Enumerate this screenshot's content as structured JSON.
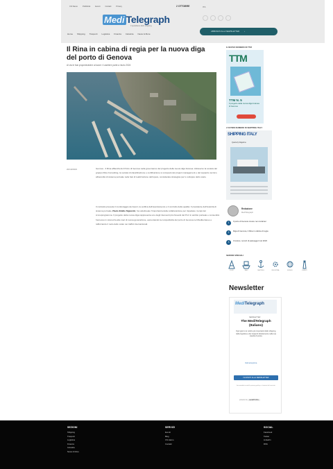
{
  "header": {
    "top_links": [
      "Chi Siamo",
      "Pubblicità",
      "Eventi",
      "Contatti",
      "Privacy"
    ],
    "date": "2 OTTOBRE",
    "lang": "ITA",
    "logo_prefix": "Medi",
    "logo_main": "Telegraph",
    "logo_sub": "Il quotidiano dello shipping",
    "nav": [
      "Home",
      "Shipping",
      "Trasporti",
      "Logistica",
      "Finanza",
      "Industria",
      "News & More"
    ],
    "cta": "ABBONATI ALLA NEWSLETTER",
    "cta_arrow": "›"
  },
  "article": {
    "title": "Il Rina in cabina di regia per la nuova diga del porto di Genova",
    "subtitle": "Al via le fasi propedeutiche ai lavori: il cantiere parte a inizio 2024",
    "date": "20/10/2023",
    "paragraph1": "Genova - Il Rina affiancherà il Porto di Genova nella governance del progetto della nuova diga foranea. Attraverso la società del gruppo Rina Consulting, la società di classificazione e certificazione si occuperà del project management e del supporto tecnico all'autorità di sistema portuale nelle fasi di realizzazione dell'opera, considerata strategica per lo sviluppo dello scalo.",
    "paragraph2_start": "Il contratto prevede il monitoraggio dei lavori, la verifica dell'avanzamento e il controllo della qualità. Il presidente dell'Autorità di sistema portuale, ",
    "paragraph2_bold": "Paolo Emilio Signorini",
    "paragraph2_end": ", ha sottolineato l'importanza della collaborazione per rispettare i tempi del cronoprogramma. Il progetto della nuova diga rappresenta uno degli interventi più rilevanti del Pnrr in ambito portuale e consentirà l'accesso in sicurezza alle navi di nuova generazione, aumentando la competitività del porto di Genova nel Mediterraneo e rafforzando il ruolo dello scalo nei traffici internazionali."
  },
  "sidebar": {
    "tm_section": "IL NUOVO NUMERO DI TTM",
    "tm_logo": "TTM",
    "tm_title": "TTM N. 5",
    "tm_subtitle": "Il progetto della nuova diga foranea di Genova",
    "shipping_section": "L'ULTIMO NUMERO DI SHIPPING ITALY",
    "shipping_logo": "SHIPPING ITALY",
    "shipping_sub": "Quarterly Magazine",
    "author_name": "Redazione",
    "author_role": "MediTelegraph",
    "ranking": [
      {
        "num": "1",
        "text": "Il porto di Genova cresce nei container"
      },
      {
        "num": "2",
        "text": "Diga di Genova, il Rina in cabina di regia"
      },
      {
        "num": "3",
        "text": "Crociere, record di passeggeri nel 2023"
      }
    ],
    "icons_section": "SEZIONI SPECIALI",
    "icons": [
      {
        "name": "ports-icon",
        "label": "PORTI"
      },
      {
        "name": "ship-icon",
        "label": "NAVI"
      },
      {
        "name": "anchor-icon",
        "label": "SHIPPING"
      },
      {
        "name": "gear-icon",
        "label": "INDUSTRIA"
      },
      {
        "name": "globe-icon",
        "label": "MONDO"
      },
      {
        "name": "lighthouse-icon",
        "label": "EVENTI"
      }
    ],
    "newsletter": {
      "title": "Newsletter",
      "logo_prefix": "Medi",
      "logo_main": "Telegraph",
      "kicker": "NEWSLETTER",
      "name": "The MediTelegraph (Italiano)",
      "desc": "Ogni giorno le notizie più importanti dello shipping, della logistica e dei trasporti direttamente nella tua casella di posta.",
      "link": "Vedi anteprima",
      "button": "ISCRIVITI ALLA NEWSLETTER",
      "fine": "Iscrivendoti accetti la privacy policy e i termini del servizio.",
      "captcha_label": "protetto da",
      "captcha_value": "reCAPTCHA"
    }
  },
  "footer": {
    "col1": {
      "head": "SEZIONI",
      "items": [
        "Shipping",
        "Trasporti",
        "Logistica",
        "Finanza",
        "Industria",
        "News & More"
      ]
    },
    "col2": {
      "head": "SERVIZI",
      "items": [
        "Eventi",
        "Blog",
        "Chi siamo",
        "Contatti"
      ]
    },
    "col3": {
      "head": "SOCIAL",
      "items": [
        "Facebook",
        "Twitter",
        "LinkedIn",
        "RSS"
      ]
    }
  },
  "colors": {
    "accent": "#1b4d86",
    "cta": "#1f5e68",
    "footer": "#060606",
    "ranking": "#1b5a8a"
  }
}
